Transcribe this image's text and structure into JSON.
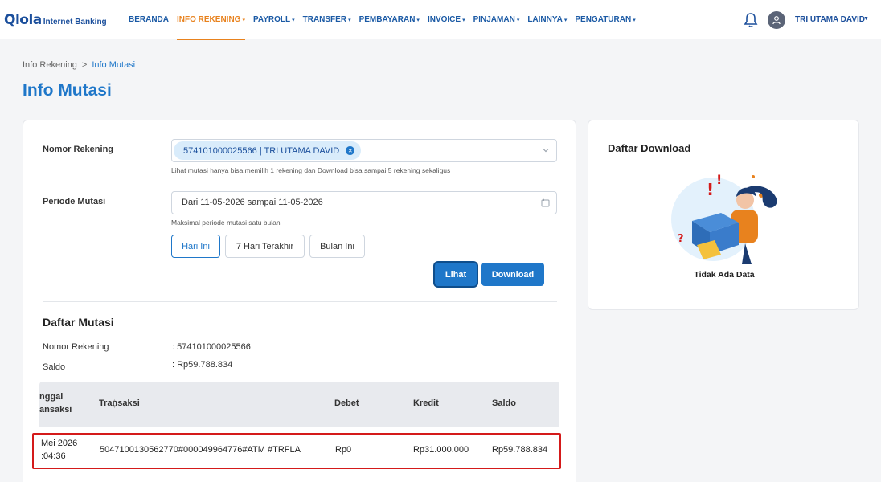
{
  "brand": {
    "logo_text": "Qlola",
    "logo_sub": "Internet Banking"
  },
  "nav": {
    "items": [
      {
        "label": "BERANDA",
        "has_caret": false,
        "active": false
      },
      {
        "label": "INFO REKENING",
        "has_caret": true,
        "active": true
      },
      {
        "label": "PAYROLL",
        "has_caret": true,
        "active": false
      },
      {
        "label": "TRANSFER",
        "has_caret": true,
        "active": false
      },
      {
        "label": "PEMBAYARAN",
        "has_caret": true,
        "active": false
      },
      {
        "label": "INVOICE",
        "has_caret": true,
        "active": false
      },
      {
        "label": "PINJAMAN",
        "has_caret": true,
        "active": false
      },
      {
        "label": "LAINNYA",
        "has_caret": true,
        "active": false
      },
      {
        "label": "PENGATURAN",
        "has_caret": true,
        "active": false
      }
    ],
    "user_name": "TRI UTAMA DAVID"
  },
  "breadcrumb": {
    "parent": "Info Rekening",
    "separator": ">",
    "current": "Info Mutasi"
  },
  "page_title": "Info Mutasi",
  "form": {
    "account_label": "Nomor Rekening",
    "account_chip": "574101000025566 | TRI UTAMA DAVID",
    "account_hint": "Lihat mutasi hanya bisa memilih 1 rekening dan Download bisa sampai 5 rekening sekaligus",
    "period_label": "Periode Mutasi",
    "period_value": "Dari 11-05-2026 sampai 11-05-2026",
    "period_hint": "Maksimal periode mutasi satu bulan",
    "quick_buttons": [
      "Hari Ini",
      "7 Hari Terakhir",
      "Bulan Ini"
    ],
    "active_quick": "Hari Ini",
    "view_button": "Lihat",
    "download_button": "Download"
  },
  "mutasi": {
    "title": "Daftar Mutasi",
    "account_label": "Nomor Rekening",
    "account_value": ": 574101000025566",
    "balance_label": "Saldo",
    "balance_value": ": Rp59.788.834",
    "columns": {
      "date_line1": "nggal",
      "date_line2": "ansaksi",
      "transaction": "Transaksi",
      "debit": "Debet",
      "credit": "Kredit",
      "balance": "Saldo"
    },
    "rows": [
      {
        "date_line1": "Mei 2026",
        "date_line2": ":04:36",
        "transaction": "5047100130562770#000049964776#ATM #TRFLA",
        "debit": "Rp0",
        "credit": "Rp31.000.000",
        "balance": "Rp59.788.834"
      }
    ]
  },
  "download_panel": {
    "title": "Daftar Download",
    "empty_text": "Tidak Ada Data"
  },
  "colors": {
    "primary": "#1f77c9",
    "active_nav": "#e8821e",
    "highlight_border": "#d41a1a"
  }
}
